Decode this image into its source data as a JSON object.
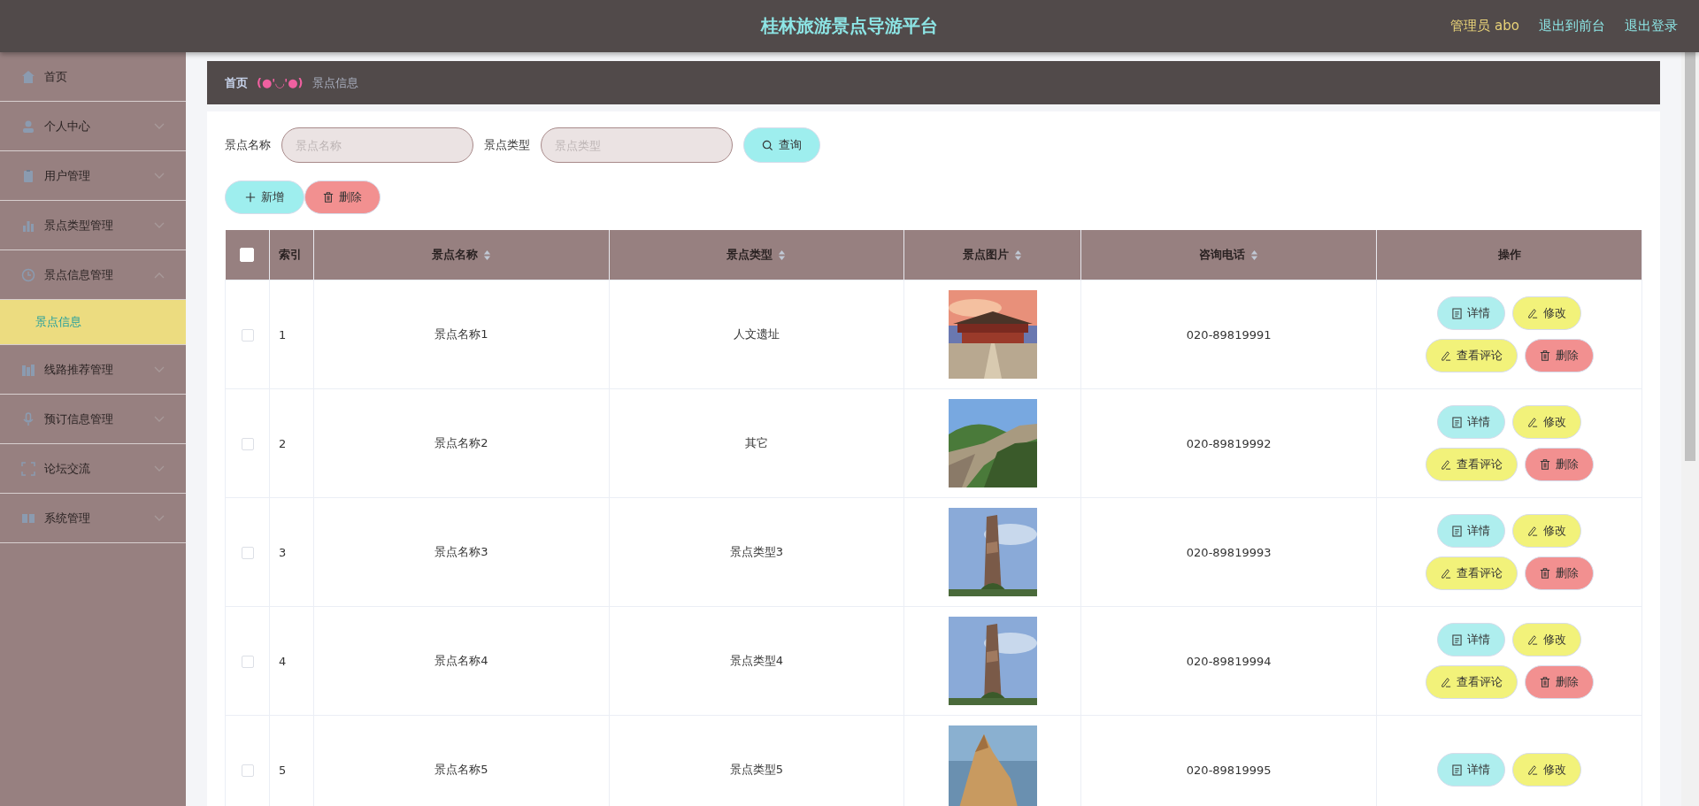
{
  "header": {
    "title": "桂林旅游景点导游平台",
    "user": "管理员 abo",
    "links": [
      "退出到前台",
      "退出登录"
    ]
  },
  "sidebar": {
    "items": [
      {
        "label": "首页",
        "kind": "link"
      },
      {
        "label": "个人中心",
        "kind": "menu",
        "expanded": false
      },
      {
        "label": "用户管理",
        "kind": "menu",
        "expanded": false
      },
      {
        "label": "景点类型管理",
        "kind": "menu",
        "expanded": false
      },
      {
        "label": "景点信息管理",
        "kind": "menu",
        "expanded": true,
        "children": [
          {
            "label": "景点信息",
            "selected": true
          }
        ]
      },
      {
        "label": "线路推荐管理",
        "kind": "menu",
        "expanded": false
      },
      {
        "label": "预订信息管理",
        "kind": "menu",
        "expanded": false
      },
      {
        "label": "论坛交流",
        "kind": "menu",
        "expanded": false
      },
      {
        "label": "系统管理",
        "kind": "menu",
        "expanded": false
      }
    ]
  },
  "breadcrumb": {
    "home": "首页",
    "separator": "(●'◡'●)",
    "current": "景点信息"
  },
  "search": {
    "fields": [
      {
        "label": "景点名称",
        "placeholder": "景点名称"
      },
      {
        "label": "景点类型",
        "placeholder": "景点类型"
      }
    ],
    "button": "查询"
  },
  "actions": {
    "add": "新增",
    "delete": "删除"
  },
  "table": {
    "all_checked": false,
    "columns": [
      {
        "label": "索引",
        "sortable": false
      },
      {
        "label": "景点名称",
        "sortable": true
      },
      {
        "label": "景点类型",
        "sortable": true
      },
      {
        "label": "景点图片",
        "sortable": true
      },
      {
        "label": "咨询电话",
        "sortable": true
      },
      {
        "label": "操作",
        "sortable": false
      }
    ],
    "rows": [
      {
        "checked": false,
        "index": "1",
        "name": "景点名称1",
        "type": "人文遗址",
        "phone": "020-89819991",
        "buttons": [
          {
            "label": "详情",
            "kind": "detail"
          },
          {
            "label": "修改",
            "kind": "edit"
          },
          {
            "label": "查看评论",
            "kind": "comment"
          },
          {
            "label": "删除",
            "kind": "delete"
          }
        ]
      },
      {
        "checked": false,
        "index": "2",
        "name": "景点名称2",
        "type": "其它",
        "phone": "020-89819992",
        "buttons": [
          {
            "label": "详情",
            "kind": "detail"
          },
          {
            "label": "修改",
            "kind": "edit"
          },
          {
            "label": "查看评论",
            "kind": "comment"
          },
          {
            "label": "删除",
            "kind": "delete"
          }
        ]
      },
      {
        "checked": false,
        "index": "3",
        "name": "景点名称3",
        "type": "景点类型3",
        "phone": "020-89819993",
        "buttons": [
          {
            "label": "详情",
            "kind": "detail"
          },
          {
            "label": "修改",
            "kind": "edit"
          },
          {
            "label": "查看评论",
            "kind": "comment"
          },
          {
            "label": "删除",
            "kind": "delete"
          }
        ]
      },
      {
        "checked": false,
        "index": "4",
        "name": "景点名称4",
        "type": "景点类型4",
        "phone": "020-89819994",
        "buttons": [
          {
            "label": "详情",
            "kind": "detail"
          },
          {
            "label": "修改",
            "kind": "edit"
          },
          {
            "label": "查看评论",
            "kind": "comment"
          },
          {
            "label": "删除",
            "kind": "delete"
          }
        ]
      },
      {
        "checked": false,
        "index": "5",
        "name": "景点名称5",
        "type": "景点类型5",
        "phone": "020-89819995",
        "buttons": [
          {
            "label": "详情",
            "kind": "detail"
          },
          {
            "label": "修改",
            "kind": "edit"
          }
        ]
      }
    ]
  }
}
